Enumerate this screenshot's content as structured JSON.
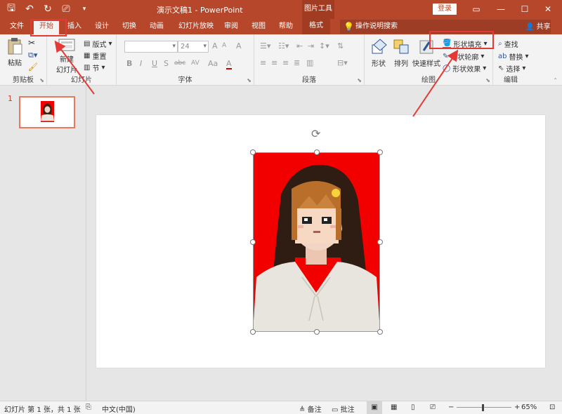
{
  "titlebar": {
    "doc_title": "演示文稿1 - PowerPoint",
    "context_tool_group": "图片工具",
    "login_label": "登录",
    "colors": {
      "titlebar": "#b7472a",
      "ribbon": "#f3f3f3"
    }
  },
  "tabs": {
    "file": "文件",
    "home": "开始",
    "insert": "插入",
    "design": "设计",
    "transitions": "切换",
    "animations": "动画",
    "slideshow": "幻灯片放映",
    "review": "审阅",
    "view": "视图",
    "help": "帮助",
    "format": "格式",
    "search_placeholder": "操作说明搜索",
    "share": "共享"
  },
  "ribbon": {
    "clipboard": {
      "label": "剪贴板",
      "paste": "粘贴"
    },
    "slides": {
      "label": "幻灯片",
      "new_slide_line1": "新建",
      "new_slide_line2": "幻灯片",
      "layout": "版式",
      "reset": "重置",
      "section": "节"
    },
    "font": {
      "label": "字体",
      "font_name": "",
      "font_size": "24",
      "bold": "B",
      "italic": "I",
      "underline": "U",
      "strike": "S",
      "shadow": "abc",
      "spacing": "AV",
      "case": "Aa",
      "color_a": "A",
      "grow": "A",
      "shrink": "A",
      "clear": "A"
    },
    "paragraph": {
      "label": "段落"
    },
    "drawing": {
      "label": "绘图",
      "shapes": "形状",
      "arrange": "排列",
      "quick_styles": "快速样式",
      "shape_fill": "形状填充",
      "shape_outline": "形状轮廓",
      "shape_effects": "形状效果"
    },
    "editing": {
      "label": "编辑",
      "find": "查找",
      "replace": "替换",
      "select": "选择"
    }
  },
  "slide_pane": {
    "slide_number": "1"
  },
  "statusbar": {
    "slide_info": "幻灯片 第 1 张，共 1 张",
    "language": "中文(中国)",
    "notes": "备注",
    "comments": "批注",
    "zoom": "65%"
  }
}
